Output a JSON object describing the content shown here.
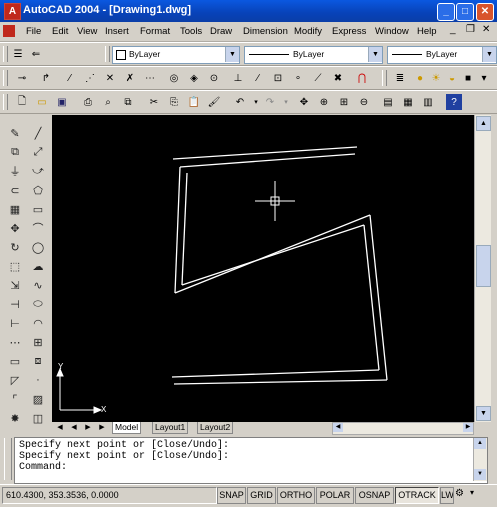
{
  "window": {
    "title": "AutoCAD 2004 - [Drawing1.dwg]",
    "app_icon_glyph": "A",
    "minimize_glyph": "_",
    "maximize_glyph": "□",
    "close_glyph": "✕"
  },
  "menu": [
    {
      "label": "File"
    },
    {
      "label": "Edit"
    },
    {
      "label": "View"
    },
    {
      "label": "Insert"
    },
    {
      "label": "Format"
    },
    {
      "label": "Tools"
    },
    {
      "label": "Draw"
    },
    {
      "label": "Dimension"
    },
    {
      "label": "Modify"
    },
    {
      "label": "Express"
    },
    {
      "label": "Window"
    },
    {
      "label": "Help"
    }
  ],
  "properties_toolbar": {
    "color_value": "ByLayer",
    "linetype_value": "ByLayer",
    "lineweight_value": "ByLayer"
  },
  "layout_tabs": [
    "Model",
    "Layout1",
    "Layout2"
  ],
  "command_line": {
    "history": [
      "Specify next point or [Close/Undo]:",
      "Specify next point or [Close/Undo]:"
    ],
    "prompt": "Command:"
  },
  "status": {
    "coordinates": "610.4300, 353.3536, 0.0000",
    "toggles": [
      {
        "label": "SNAP",
        "on": false
      },
      {
        "label": "GRID",
        "on": false
      },
      {
        "label": "ORTHO",
        "on": false
      },
      {
        "label": "POLAR",
        "on": false
      },
      {
        "label": "OSNAP",
        "on": false
      },
      {
        "label": "OTRACK",
        "on": true
      },
      {
        "label": "LWT",
        "on": false
      }
    ]
  },
  "ucs": {
    "x_label": "X",
    "y_label": "Y"
  },
  "colors": {
    "titlebar": "#0842b8",
    "canvas": "#000000",
    "drawing_lines": "#ffffff"
  }
}
